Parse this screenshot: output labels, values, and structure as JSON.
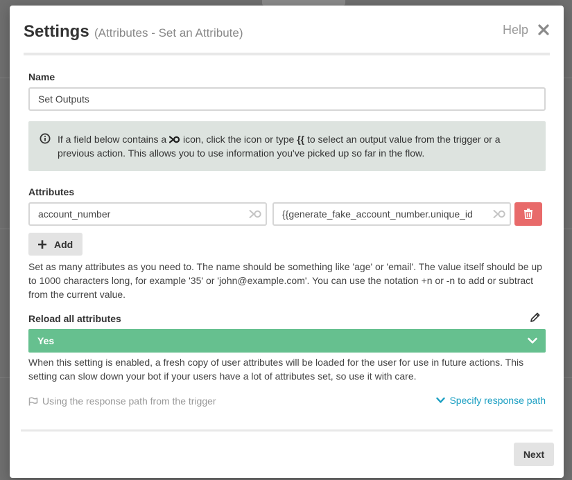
{
  "modal": {
    "title": "Settings",
    "subtitle": "(Attributes - Set an Attribute)",
    "help_label": "Help",
    "close_icon": "close-icon"
  },
  "name_field": {
    "label": "Name",
    "value": "Set Outputs"
  },
  "info_box": {
    "icon": "info-icon",
    "text_before": "If a field below contains a ",
    "text_after_icon": " icon, click the icon or type ",
    "token": "{{",
    "text_after_token": " to select an output value from the trigger or a previous action. This allows you to use information you've picked up so far in the flow."
  },
  "attributes": {
    "label": "Attributes",
    "rows": [
      {
        "name": "account_number",
        "value": "{{generate_fake_account_number.unique_id"
      }
    ],
    "add_label": "Add",
    "help_text": "Set as many attributes as you need to. The name should be something like 'age' or 'email'. The value itself should be up to 1000 characters long, for example '35' or 'john@example.com'. You can use the notation +n or -n to add or subtract from the current value."
  },
  "reload": {
    "label": "Reload all attributes",
    "selected": "Yes",
    "help_text": "When this setting is enabled, a fresh copy of user attributes will be loaded for the user for use in future actions. This setting can slow down your bot if your users have a lot of attributes set, so use it with care."
  },
  "response_path": {
    "text": "Using the response path from the trigger",
    "specify_label": "Specify response path"
  },
  "footer": {
    "next_label": "Next"
  },
  "colors": {
    "success_green": "#66c08f",
    "danger_red": "#e86a6a",
    "link_blue": "#1b9fc2",
    "info_bg": "#dde3df"
  }
}
